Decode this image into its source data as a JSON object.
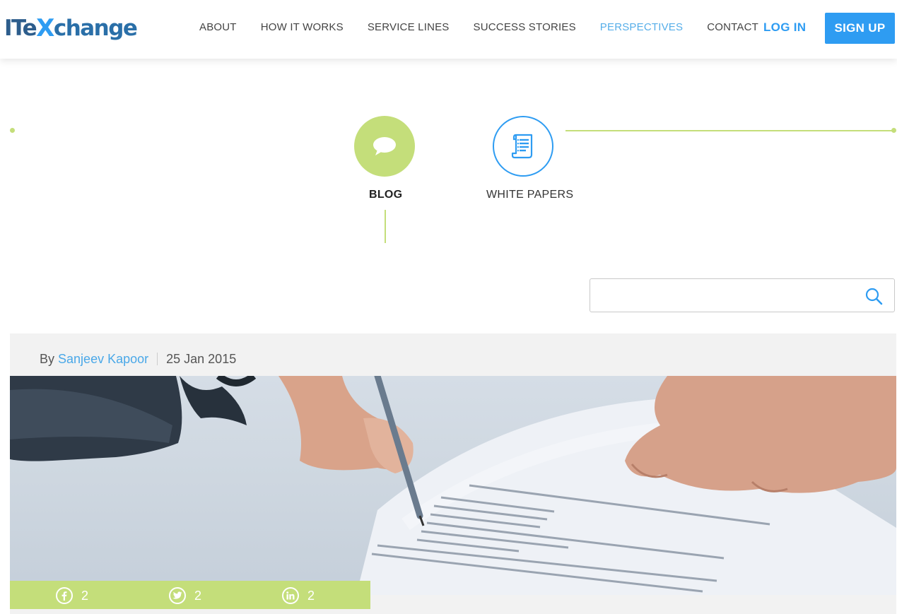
{
  "header": {
    "logo": {
      "part1": "ITe",
      "part_x": "X",
      "part2": "change"
    },
    "nav": [
      {
        "label": "ABOUT",
        "active": false
      },
      {
        "label": "HOW IT WORKS",
        "active": false
      },
      {
        "label": "SERVICE LINES",
        "active": false
      },
      {
        "label": "SUCCESS STORIES",
        "active": false
      },
      {
        "label": "PERSPECTIVES",
        "active": true
      },
      {
        "label": "CONTACT",
        "active": false
      }
    ],
    "login_label": "LOG IN",
    "signup_label": "SIGN UP"
  },
  "tabs": [
    {
      "label": "BLOG",
      "icon": "speech-bubble-icon",
      "selected": true
    },
    {
      "label": "WHITE PAPERS",
      "icon": "document-scroll-icon",
      "selected": false
    }
  ],
  "search": {
    "value": "",
    "placeholder": "",
    "icon": "search-icon"
  },
  "post": {
    "by_prefix": "By",
    "author": "Sanjeev Kapoor",
    "date": "25 Jan 2015",
    "image_alt": "hand signing a document with a pen",
    "share": [
      {
        "network": "facebook",
        "icon": "facebook-icon",
        "count": "2"
      },
      {
        "network": "twitter",
        "icon": "twitter-icon",
        "count": "2"
      },
      {
        "network": "linkedin",
        "icon": "linkedin-icon",
        "count": "2"
      }
    ]
  },
  "colors": {
    "accent_blue": "#2e9cf2",
    "accent_green": "#c4de7a",
    "active_nav": "#56aee9"
  }
}
